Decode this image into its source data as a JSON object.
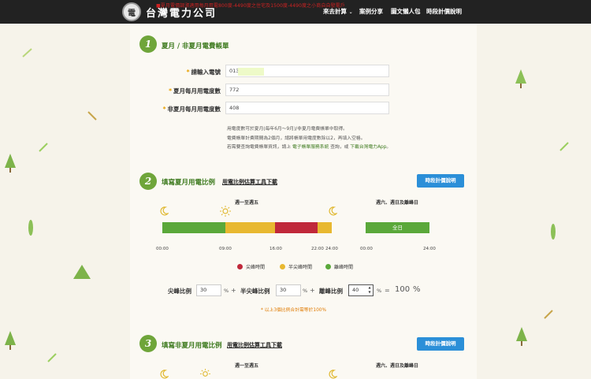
{
  "header": {
    "notice": "■夏月電價調漲適用每月用電800度-4490度之住宅及1500度-4490度之小商自自發電戶",
    "brand": "台灣電力公司",
    "nav": [
      "來去計算",
      "案例分享",
      "圖文懶人包",
      "時段計價說明"
    ]
  },
  "step1": {
    "number": "1",
    "title": "夏月 / 非夏月電費帳單",
    "fields": [
      {
        "label": "請輸入電號",
        "value": "013"
      },
      {
        "label": "夏月每月用電度數",
        "value": "772"
      },
      {
        "label": "非夏月每月用電度數",
        "value": "408"
      }
    ],
    "note1": "用電度數可於夏月(每年6月～9月)/非夏月電費帳單中取得。",
    "note2": "電費帳單計費期間為2個月，請將帳單用電度數除以2，再填入空格。",
    "note3_prefix": "若需要查詢電費帳單資訊，請上",
    "note3_link1": "電子帳單服務系統",
    "note3_mid": "查詢，或",
    "note3_link2": "下載台灣電力App",
    "note3_suffix": "。"
  },
  "step2": {
    "number": "2",
    "title": "填寫夏月用電比例",
    "link": "用電比例估算工具下載",
    "button": "時段計價說明",
    "weekday_header": "週一至週五",
    "weekend_header": "週六、週日及離峰日",
    "weekday_ticks": [
      "00:00",
      "09:00",
      "16:00",
      "22:00",
      "24:00"
    ],
    "weekend_ticks": [
      "00:00",
      "24:00"
    ],
    "weekend_bar_label": "全日",
    "legend": [
      {
        "label": "尖峰時間",
        "color": "#c0283a"
      },
      {
        "label": "半尖峰時間",
        "color": "#e8b830"
      },
      {
        "label": "離峰時間",
        "color": "#5aa83a"
      }
    ],
    "ratios": {
      "peak_label": "尖峰比例",
      "peak_value": "30",
      "half_label": "半尖峰比例",
      "half_value": "30",
      "off_label": "離峰比例",
      "off_value": "40",
      "percent": "%",
      "plus": "+",
      "equals": "=",
      "total": "100",
      "total_unit": "%"
    },
    "warning": "* 以上3個比例合計需等於100%"
  },
  "step3": {
    "number": "3",
    "title": "填寫非夏月用電比例",
    "link": "用電比例估算工具下載",
    "button": "時段計價說明",
    "weekday_header": "週一至週五",
    "weekend_header": "週六、週日及離峰日"
  }
}
